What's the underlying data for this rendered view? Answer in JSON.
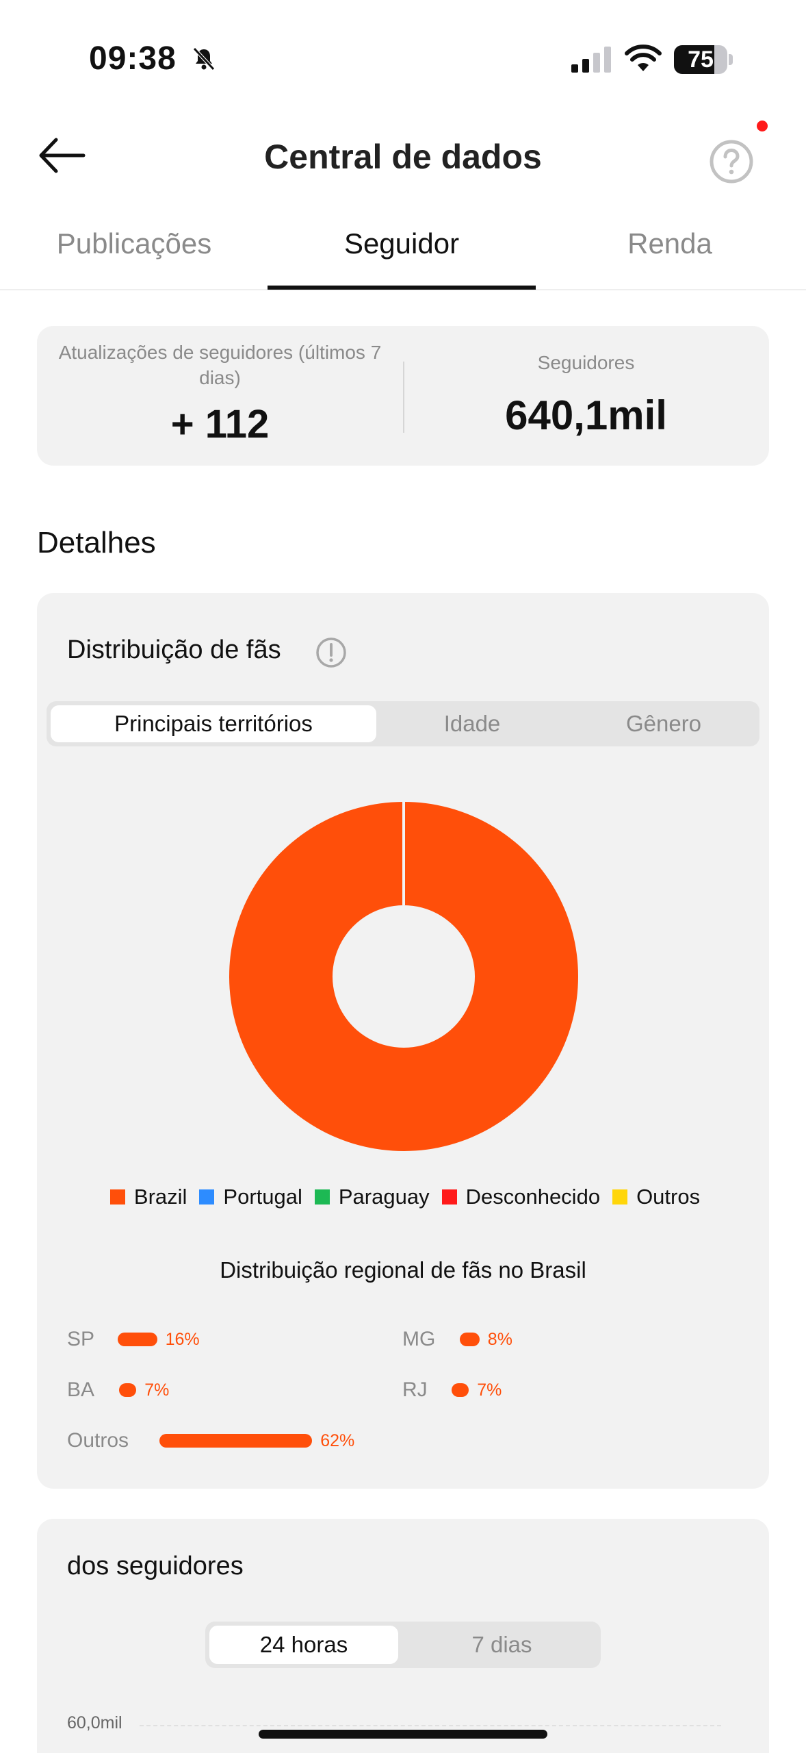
{
  "status_bar": {
    "time": "09:38",
    "battery": "75",
    "battery_level": 0.75
  },
  "header": {
    "title": "Central de dados"
  },
  "tabs": [
    {
      "label": "Publicações",
      "active": false
    },
    {
      "label": "Seguidor",
      "active": true
    },
    {
      "label": "Renda",
      "active": false
    }
  ],
  "summary": {
    "updates_label": "Atualizações de seguidores (últimos 7 dias)",
    "updates_value": "+ 112",
    "followers_label": "Seguidores",
    "followers_value": "640,1mil"
  },
  "details": {
    "title": "Detalhes"
  },
  "distribution": {
    "title": "Distribuição de fãs",
    "segments": [
      {
        "label": "Principais territórios",
        "active": true
      },
      {
        "label": "Idade",
        "active": false
      },
      {
        "label": "Gênero",
        "active": false
      }
    ],
    "legend": [
      {
        "label": "Brazil",
        "color": "#ff4f0a"
      },
      {
        "label": "Portugal",
        "color": "#2d8cff"
      },
      {
        "label": "Paraguay",
        "color": "#1db954"
      },
      {
        "label": "Desconhecido",
        "color": "#ff1a1a"
      },
      {
        "label": "Outros",
        "color": "#ffd60a"
      }
    ],
    "regional_title": "Distribuição regional de fãs no Brasil",
    "regions": [
      {
        "label": "SP",
        "value": "16%",
        "pct": 16
      },
      {
        "label": "MG",
        "value": "8%",
        "pct": 8
      },
      {
        "label": "BA",
        "value": "7%",
        "pct": 7
      },
      {
        "label": "RJ",
        "value": "7%",
        "pct": 7
      },
      {
        "label": "Outros",
        "value": "62%",
        "pct": 62
      }
    ]
  },
  "activity": {
    "title": "dos seguidores",
    "segments": [
      {
        "label": "24 horas",
        "active": true
      },
      {
        "label": "7 dias",
        "active": false
      }
    ],
    "y_tick": "60,0mil"
  },
  "chart_data": {
    "type": "pie",
    "categories": [
      "Brazil",
      "Portugal",
      "Paraguay",
      "Desconhecido",
      "Outros"
    ],
    "values": [
      99.9,
      0.03,
      0.03,
      0.02,
      0.02
    ]
  }
}
